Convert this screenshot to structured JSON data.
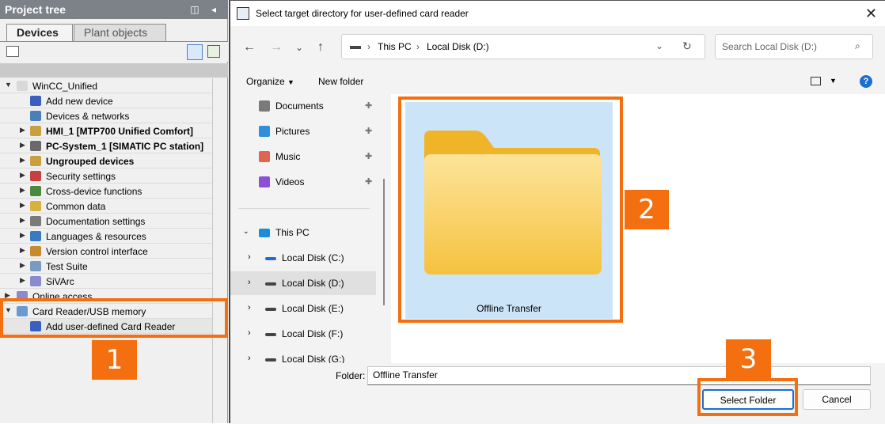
{
  "project_tree": {
    "title": "Project tree",
    "title_icons": "◫ ◂",
    "tabs": [
      "Devices",
      "Plant objects"
    ],
    "items": [
      {
        "label": "WinCC_Unified",
        "arrow": "▼",
        "bold": false,
        "indent": 0
      },
      {
        "label": "Add new device",
        "arrow": "",
        "bold": false,
        "indent": 1
      },
      {
        "label": "Devices & networks",
        "arrow": "",
        "bold": false,
        "indent": 1
      },
      {
        "label": "HMI_1 [MTP700 Unified Comfort]",
        "arrow": "▶",
        "bold": true,
        "indent": 1
      },
      {
        "label": "PC-System_1 [SIMATIC PC station]",
        "arrow": "▶",
        "bold": true,
        "indent": 1
      },
      {
        "label": "Ungrouped devices",
        "arrow": "▶",
        "bold": true,
        "indent": 1
      },
      {
        "label": "Security settings",
        "arrow": "▶",
        "bold": false,
        "indent": 1
      },
      {
        "label": "Cross-device functions",
        "arrow": "▶",
        "bold": false,
        "indent": 1
      },
      {
        "label": "Common data",
        "arrow": "▶",
        "bold": false,
        "indent": 1
      },
      {
        "label": "Documentation settings",
        "arrow": "▶",
        "bold": false,
        "indent": 1
      },
      {
        "label": "Languages & resources",
        "arrow": "▶",
        "bold": false,
        "indent": 1
      },
      {
        "label": "Version control interface",
        "arrow": "▶",
        "bold": false,
        "indent": 1
      },
      {
        "label": "Test Suite",
        "arrow": "▶",
        "bold": false,
        "indent": 1
      },
      {
        "label": "SiVArc",
        "arrow": "▶",
        "bold": false,
        "indent": 1
      },
      {
        "label": "Online access",
        "arrow": "▶",
        "bold": false,
        "indent": 0
      },
      {
        "label": "Card Reader/USB memory",
        "arrow": "▼",
        "bold": false,
        "indent": 0
      },
      {
        "label": "Add user-defined Card Reader",
        "arrow": "",
        "bold": false,
        "indent": 1
      }
    ]
  },
  "dialog": {
    "title": "Select target directory for user-defined card reader",
    "close": "✕",
    "breadcrumb": [
      "This PC",
      "Local Disk (D:)"
    ],
    "search_placeholder": "Search Local Disk (D:)",
    "organize": "Organize",
    "new_folder": "New folder",
    "nav_quick": [
      {
        "label": "Documents",
        "color": "#7a7a7a"
      },
      {
        "label": "Pictures",
        "color": "#2f8fd8"
      },
      {
        "label": "Music",
        "color": "#e0644f"
      },
      {
        "label": "Videos",
        "color": "#8b4fd8"
      }
    ],
    "this_pc": "This PC",
    "drives": [
      "Local Disk (C:)",
      "Local Disk (D:)",
      "Local Disk (E:)",
      "Local Disk (F:)",
      "Local Disk (G:)"
    ],
    "folder_name": "Offline Transfer",
    "folder_label": "Folder:",
    "folder_value": "Offline Transfer",
    "select_button": "Select Folder",
    "cancel_button": "Cancel"
  },
  "callouts": [
    "1",
    "2",
    "3"
  ],
  "colors": {
    "accent": "#f46f10",
    "selected": "#cce4f7",
    "folder": "#f7c948"
  }
}
